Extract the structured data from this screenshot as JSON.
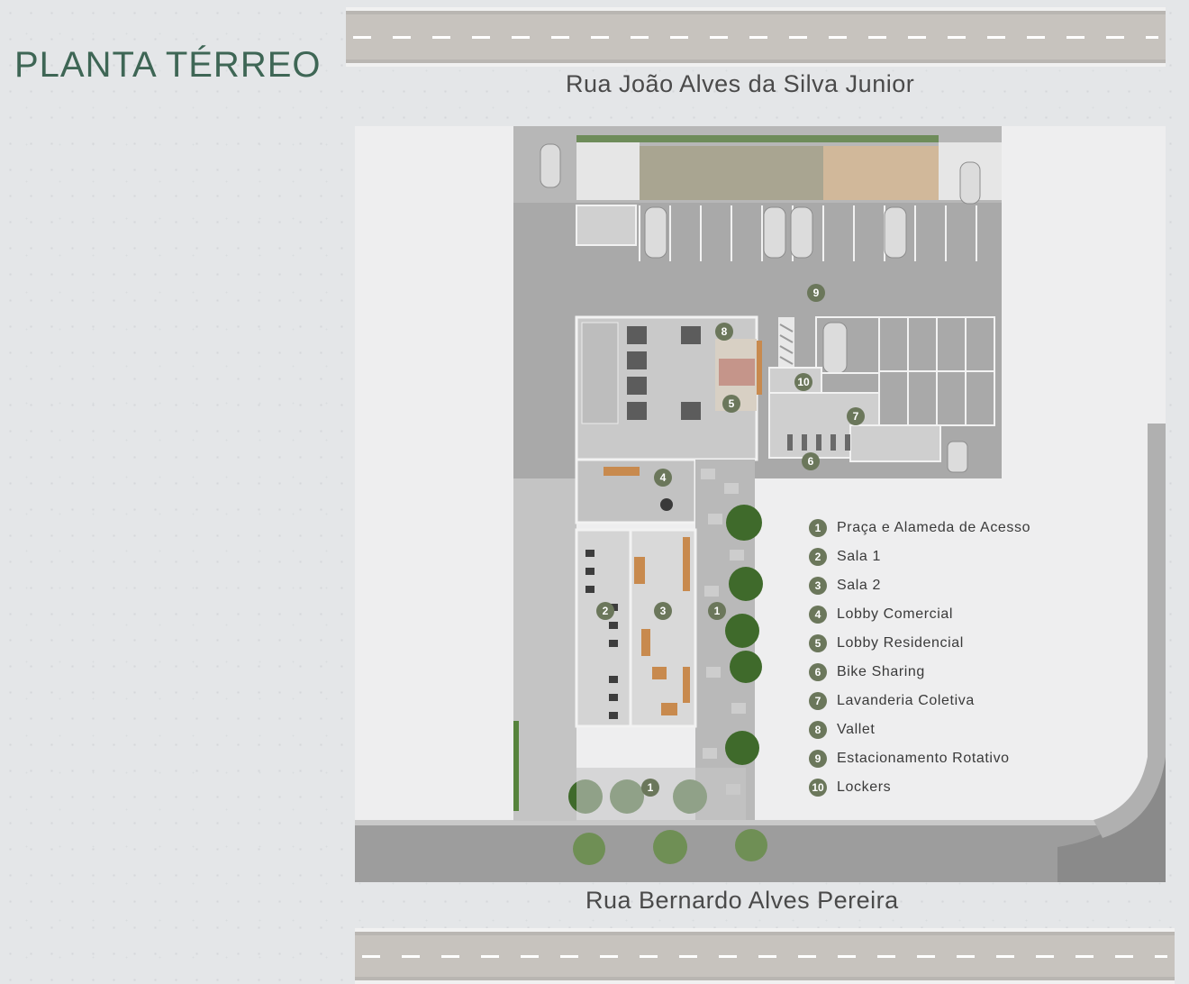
{
  "page": {
    "title": "PLANTA TÉRREO",
    "street_top": "Rua João Alves da Silva Junior",
    "street_bottom": "Rua Bernardo Alves Pereira"
  },
  "colors": {
    "title_green": "#3e6655",
    "marker_olive": "#6b775b",
    "plant_green": "#3f6a2b",
    "wood": "#c88a4e"
  },
  "plan_markers": [
    "1",
    "2",
    "3",
    "4",
    "5",
    "6",
    "7",
    "8",
    "9",
    "10",
    "1"
  ],
  "legend": [
    {
      "num": "1",
      "label": "Praça e Alameda de Acesso"
    },
    {
      "num": "2",
      "label": "Sala 1"
    },
    {
      "num": "3",
      "label": "Sala 2"
    },
    {
      "num": "4",
      "label": "Lobby Comercial"
    },
    {
      "num": "5",
      "label": "Lobby Residencial"
    },
    {
      "num": "6",
      "label": "Bike Sharing"
    },
    {
      "num": "7",
      "label": "Lavanderia Coletiva"
    },
    {
      "num": "8",
      "label": "Vallet"
    },
    {
      "num": "9",
      "label": "Estacionamento Rotativo"
    },
    {
      "num": "10",
      "label": "Lockers"
    }
  ]
}
